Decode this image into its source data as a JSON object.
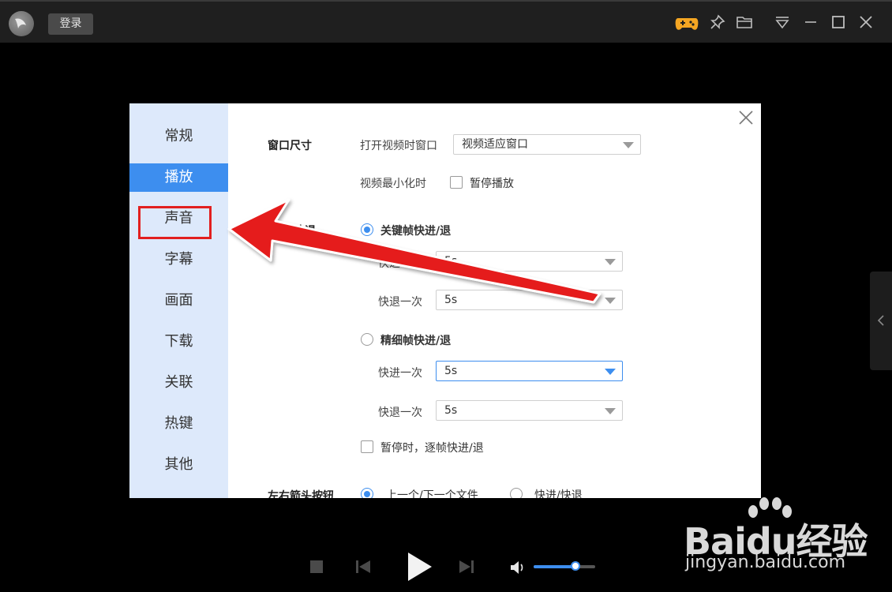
{
  "titlebar": {
    "login_label": "登录",
    "icons": [
      "game-icon",
      "pin-icon",
      "folder-icon",
      "menu-icon",
      "minimize-icon",
      "maximize-icon",
      "close-icon"
    ]
  },
  "dialog": {
    "sidebar": {
      "items": [
        "常规",
        "播放",
        "声音",
        "字幕",
        "画面",
        "下载",
        "关联",
        "热键",
        "其他"
      ],
      "active_index": 1,
      "highlighted_index": 2
    },
    "window_size": {
      "title": "窗口尺寸",
      "open_label": "打开视频时窗口",
      "open_value": "视频适应窗口",
      "minimize_label": "视频最小化时",
      "pause_option": "暂停播放"
    },
    "seek": {
      "title": "快进/快退",
      "keyframe_option": "关键帧快进/退",
      "keyframe_forward_label": "快进一次",
      "keyframe_forward_value": "5s",
      "keyframe_backward_label": "快退一次",
      "keyframe_backward_value": "5s",
      "fine_option": "精细帧快进/退",
      "fine_forward_label": "快进一次",
      "fine_forward_value": "5s",
      "fine_backward_label": "快退一次",
      "fine_backward_value": "5s",
      "frame_step_option": "暂停时，逐帧快进/退"
    },
    "arrow_keys": {
      "title": "左右箭头按钮",
      "option_file": "上一个/下一个文件",
      "option_seek": "快进/快退"
    }
  },
  "player": {
    "volume_level": 0.68
  },
  "watermark": {
    "brand": "Baidu经验",
    "url": "jingyan.baidu.com"
  },
  "colors": {
    "accent": "#3d8eef",
    "annotation_red": "#e21f1f"
  }
}
